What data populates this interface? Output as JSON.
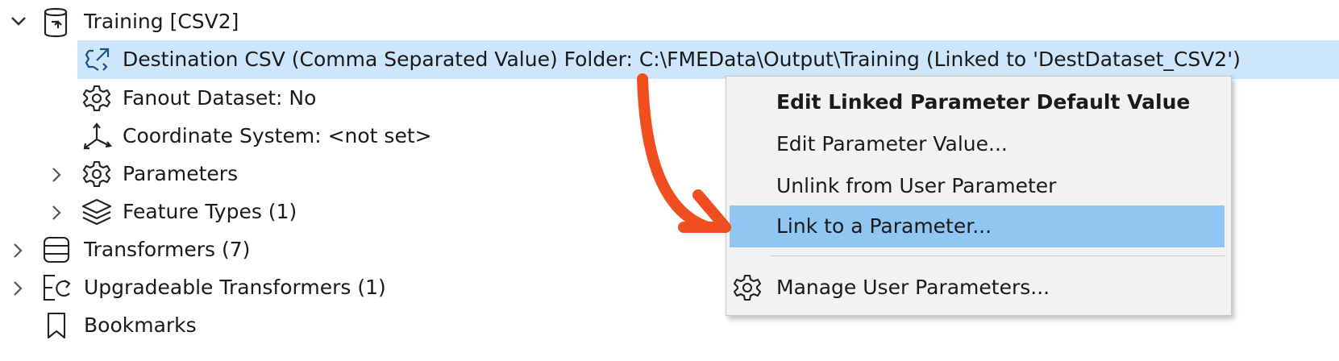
{
  "tree": {
    "root": {
      "label": "Training [CSV2]",
      "chevron": "chevron-down-icon",
      "icon": "database-output-icon"
    },
    "destination": {
      "label": "Destination CSV (Comma Separated Value) Folder: C:\\FMEData\\Output\\Training (Linked to 'DestDataset_CSV2')",
      "icon": "linked-parameter-icon"
    },
    "fanout": {
      "label": "Fanout Dataset: No",
      "icon": "gear-icon"
    },
    "coordinate": {
      "label": "Coordinate System: <not set>",
      "icon": "coordinate-axes-icon"
    },
    "parameters": {
      "label": "Parameters",
      "chevron": "chevron-right-icon",
      "icon": "gear-icon"
    },
    "feature_types": {
      "label": "Feature Types (1)",
      "chevron": "chevron-right-icon",
      "icon": "layers-icon"
    },
    "transformers": {
      "label": "Transformers (7)",
      "chevron": "chevron-right-icon",
      "icon": "transformers-icon"
    },
    "upgradeable": {
      "label": "Upgradeable Transformers (1)",
      "chevron": "chevron-right-icon",
      "icon": "upgrade-icon"
    },
    "bookmarks": {
      "label": "Bookmarks",
      "icon": "bookmark-icon"
    }
  },
  "context_menu": {
    "items": [
      {
        "label": "Edit Linked Parameter Default Value",
        "bold": true
      },
      {
        "label": "Edit Parameter Value..."
      },
      {
        "label": "Unlink from User Parameter"
      },
      {
        "label": "Link to a Parameter...",
        "highlighted": true
      },
      {
        "label": "Manage User Parameters...",
        "icon": "gear-icon"
      }
    ]
  },
  "annotation": {
    "type": "curved-arrow",
    "color": "#f04e1e"
  },
  "colors": {
    "selection": "#cde6fb",
    "menu_highlight": "#92c6f2",
    "menu_bg": "#f2f2f2"
  }
}
